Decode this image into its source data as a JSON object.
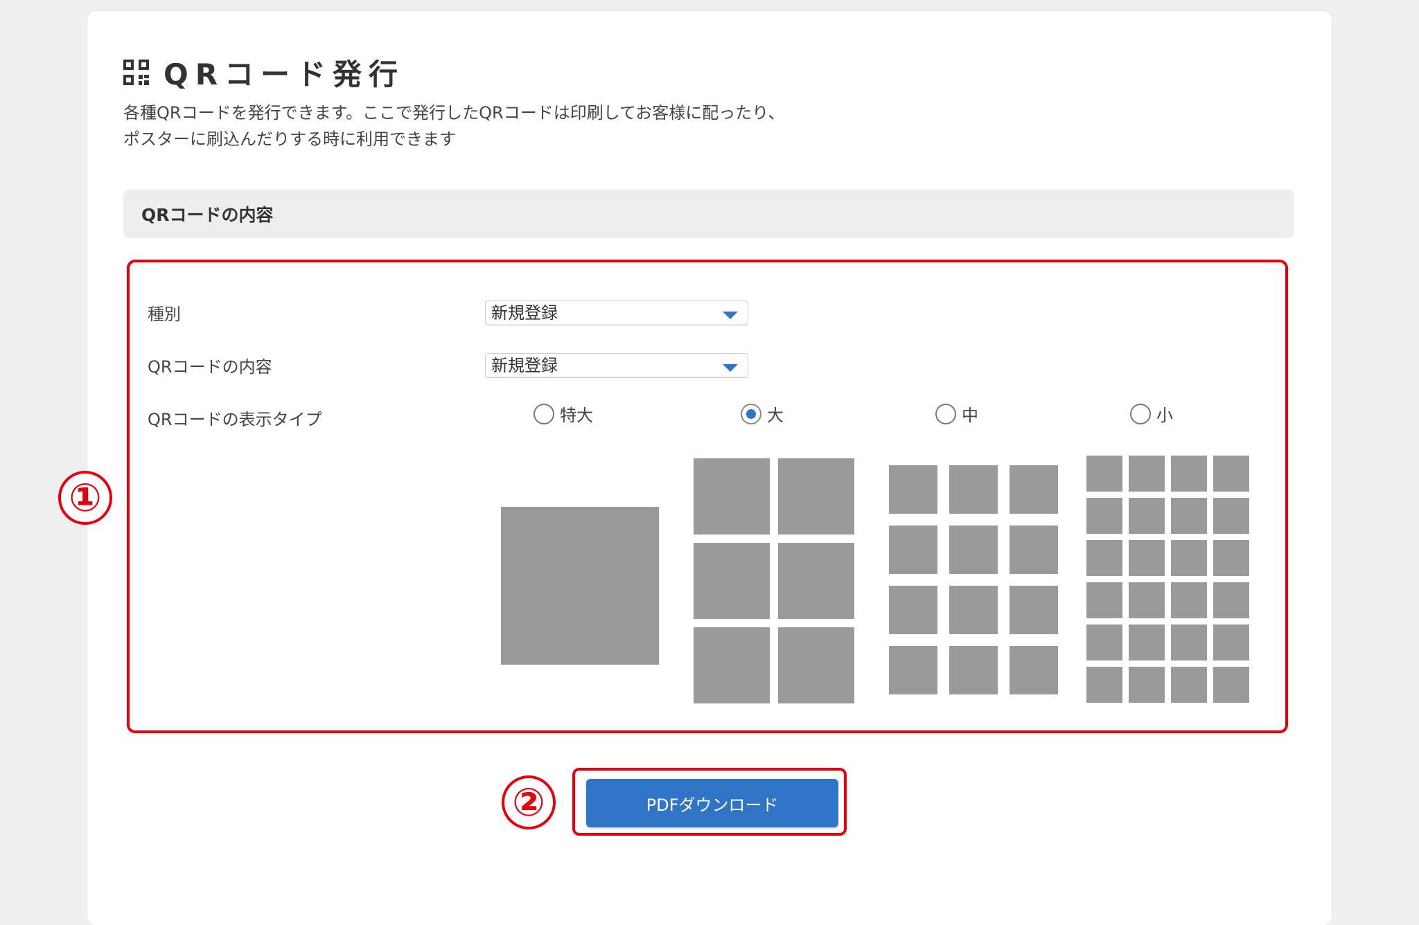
{
  "header": {
    "title": "QRコード発行",
    "icon": "qr-code-icon",
    "description_line1": "各種QRコードを発行できます。ここで発行したQRコードは印刷してお客様に配ったり、",
    "description_line2": "ポスターに刷込んだりする時に利用できます"
  },
  "section": {
    "title": "QRコードの内容"
  },
  "form": {
    "type_label": "種別",
    "type_value": "新規登録",
    "content_label": "QRコードの内容",
    "content_value": "新規登録",
    "display_type_label": "QRコードの表示タイプ",
    "options": [
      {
        "label": "特大",
        "selected": false,
        "columns": 1,
        "rows": 1
      },
      {
        "label": "大",
        "selected": true,
        "columns": 2,
        "rows": 3
      },
      {
        "label": "中",
        "selected": false,
        "columns": 3,
        "rows": 4
      },
      {
        "label": "小",
        "selected": false,
        "columns": 4,
        "rows": 6
      }
    ]
  },
  "actions": {
    "download_label": "PDFダウンロード"
  },
  "annotations": {
    "marker1": "①",
    "marker2": "②"
  },
  "colors": {
    "accent": "#2f74c5",
    "highlight": "#e8000b",
    "tile": "#9a9a9a"
  }
}
